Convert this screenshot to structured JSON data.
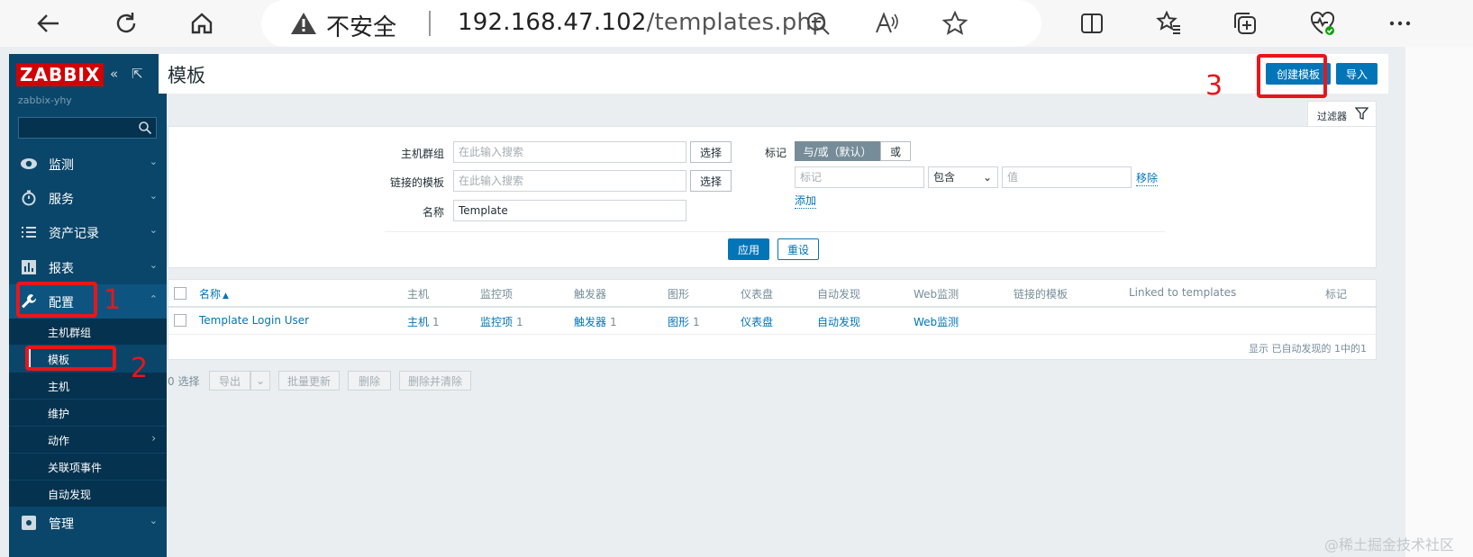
{
  "browser": {
    "insecure_label": "不安全",
    "url_host": "192.168.47.102",
    "url_path": "/templates.php"
  },
  "sidebar": {
    "logo": "ZABBIX",
    "server_name": "zabbix-yhy",
    "menu": [
      {
        "label": "监测"
      },
      {
        "label": "服务"
      },
      {
        "label": "资产记录"
      },
      {
        "label": "报表"
      },
      {
        "label": "配置"
      },
      {
        "label": "管理"
      }
    ],
    "submenu": [
      {
        "label": "主机群组"
      },
      {
        "label": "模板"
      },
      {
        "label": "主机"
      },
      {
        "label": "维护"
      },
      {
        "label": "动作"
      },
      {
        "label": "关联项事件"
      },
      {
        "label": "自动发现"
      }
    ]
  },
  "header": {
    "title": "模板",
    "create_button": "创建模板",
    "import_button": "导入"
  },
  "filter": {
    "tab_label": "过滤器",
    "host_group_label": "主机群组",
    "host_group_placeholder": "在此输入搜索",
    "linked_templates_label": "链接的模板",
    "linked_templates_placeholder": "在此输入搜索",
    "select_button": "选择",
    "name_label": "名称",
    "name_value": "Template",
    "tags_label": "标记",
    "and_or": "与/或（默认）",
    "or": "或",
    "tag_placeholder": "标记",
    "operator": "包含",
    "value_placeholder": "值",
    "remove_link": "移除",
    "add_link": "添加",
    "apply_button": "应用",
    "reset_button": "重设"
  },
  "table": {
    "headers": [
      "名称",
      "主机",
      "监控项",
      "触发器",
      "图形",
      "仪表盘",
      "自动发现",
      "Web监测",
      "链接的模板",
      "Linked to templates",
      "标记"
    ],
    "sort_indicator": "▲",
    "rows": [
      {
        "name": "Template Login User",
        "hosts": "主机",
        "hosts_count": "1",
        "items": "监控项",
        "items_count": "1",
        "triggers": "触发器",
        "triggers_count": "1",
        "graphs": "图形",
        "graphs_count": "1",
        "dashboards": "仪表盘",
        "discovery": "自动发现",
        "web": "Web监测"
      }
    ],
    "footer": "显示 已自动发现的 1中的1"
  },
  "actions": {
    "selected": "0 选择",
    "export": "导出",
    "mass_update": "批量更新",
    "delete": "删除",
    "delete_clear": "删除并清除"
  },
  "annotations": [
    "1",
    "2",
    "3"
  ],
  "watermark": "@稀土掘金技术社区",
  "colors": {
    "brand": "#d40000",
    "sidebar": "#0a466a",
    "primary": "#0275b8",
    "annotation": "#e8161b"
  }
}
